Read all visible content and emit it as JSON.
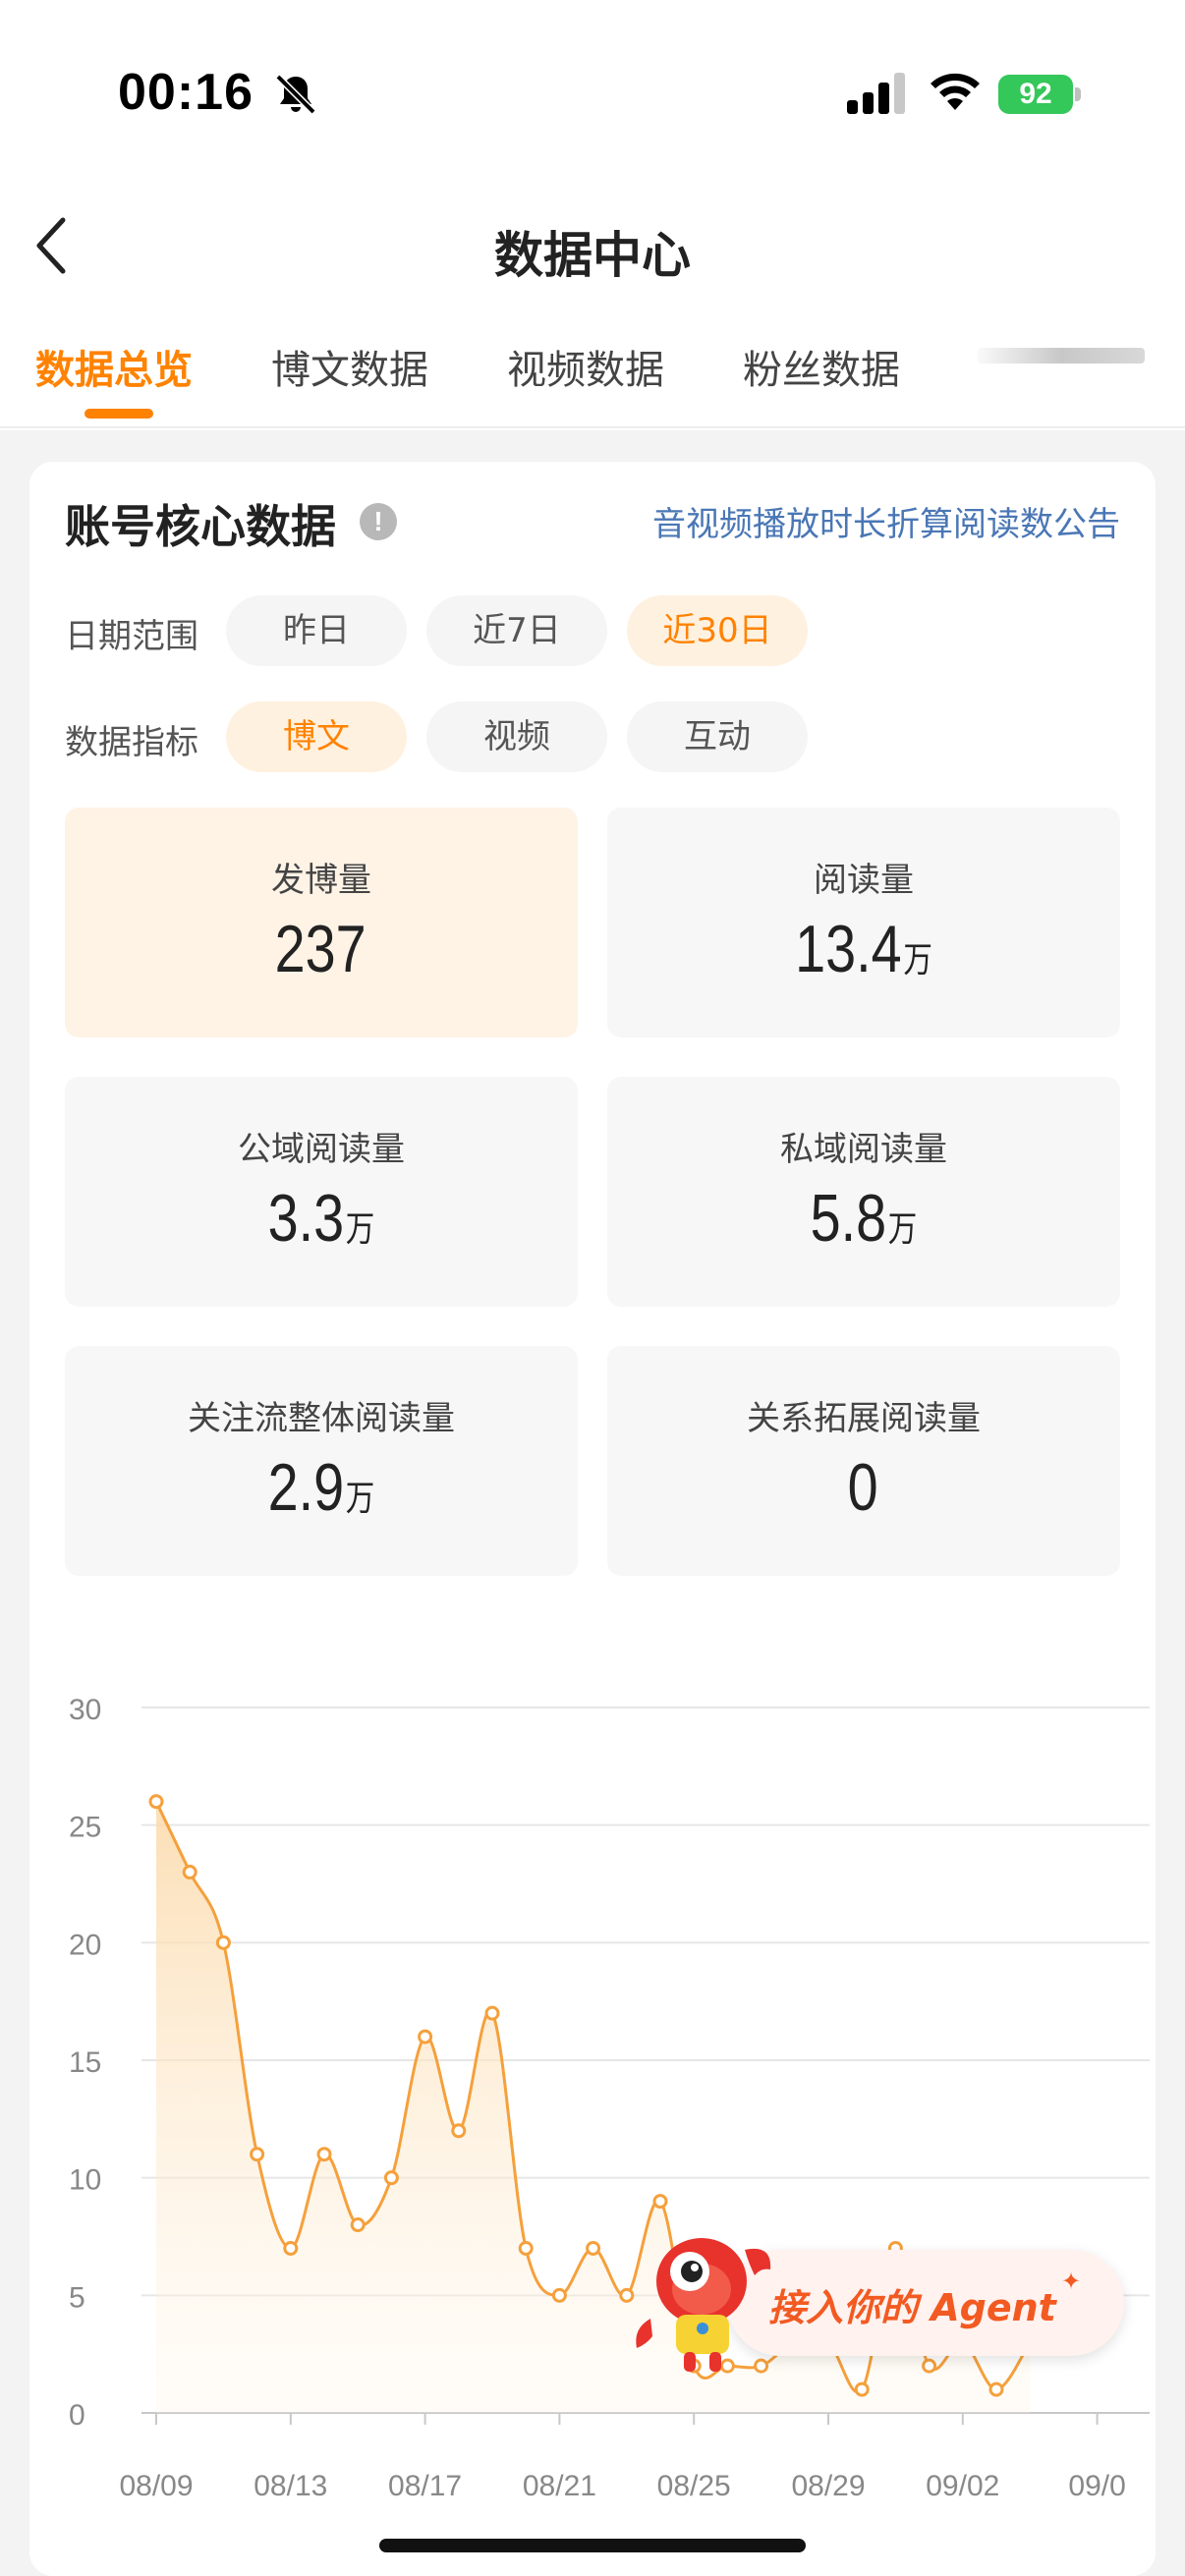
{
  "status_bar": {
    "time": "00:16",
    "battery": "92"
  },
  "header": {
    "title": "数据中心"
  },
  "tabs": [
    {
      "label": "数据总览",
      "active": true
    },
    {
      "label": "博文数据",
      "active": false
    },
    {
      "label": "视频数据",
      "active": false
    },
    {
      "label": "粉丝数据",
      "active": false
    }
  ],
  "card": {
    "title": "账号核心数据",
    "info_icon": "!",
    "notice_link": "音视频播放时长折算阅读数公告",
    "date_range": {
      "label": "日期范围",
      "options": [
        "昨日",
        "近7日",
        "近30日"
      ],
      "selected": "近30日"
    },
    "metric_type": {
      "label": "数据指标",
      "options": [
        "博文",
        "视频",
        "互动"
      ],
      "selected": "博文"
    },
    "metrics": [
      {
        "label": "发博量",
        "value": "237",
        "unit": ""
      },
      {
        "label": "阅读量",
        "value": "13.4",
        "unit": "万"
      },
      {
        "label": "公域阅读量",
        "value": "3.3",
        "unit": "万"
      },
      {
        "label": "私域阅读量",
        "value": "5.8",
        "unit": "万"
      },
      {
        "label": "关注流整体阅读量",
        "value": "2.9",
        "unit": "万"
      },
      {
        "label": "关系拓展阅读量",
        "value": "0",
        "unit": ""
      }
    ]
  },
  "chart_data": {
    "type": "area",
    "x": [
      "08/09",
      "08/10",
      "08/11",
      "08/12",
      "08/13",
      "08/14",
      "08/15",
      "08/16",
      "08/17",
      "08/18",
      "08/19",
      "08/20",
      "08/21",
      "08/22",
      "08/23",
      "08/24",
      "08/25",
      "08/26",
      "08/27",
      "08/28",
      "08/29",
      "08/30",
      "08/31",
      "09/01",
      "09/02",
      "09/03",
      "09/04"
    ],
    "values": [
      26,
      23,
      20,
      11,
      7,
      11,
      8,
      10,
      16,
      12,
      17,
      7,
      5,
      7,
      5,
      9,
      2,
      2,
      2,
      3,
      3,
      1,
      7,
      2,
      3,
      1,
      3
    ],
    "x_tick_labels": [
      "08/09",
      "08/13",
      "08/17",
      "08/21",
      "08/25",
      "08/29",
      "09/02",
      "09/0"
    ],
    "y_ticks": [
      0,
      5,
      10,
      15,
      20,
      25,
      30
    ],
    "ylim": [
      0,
      30
    ],
    "color": "#f5a03c",
    "grid": true
  },
  "agent_banner": {
    "text": "接入你的 Agent",
    "spark": "✦"
  },
  "colors": {
    "accent": "#ff8200",
    "link": "#4a77b5",
    "line": "#f5a03c"
  }
}
